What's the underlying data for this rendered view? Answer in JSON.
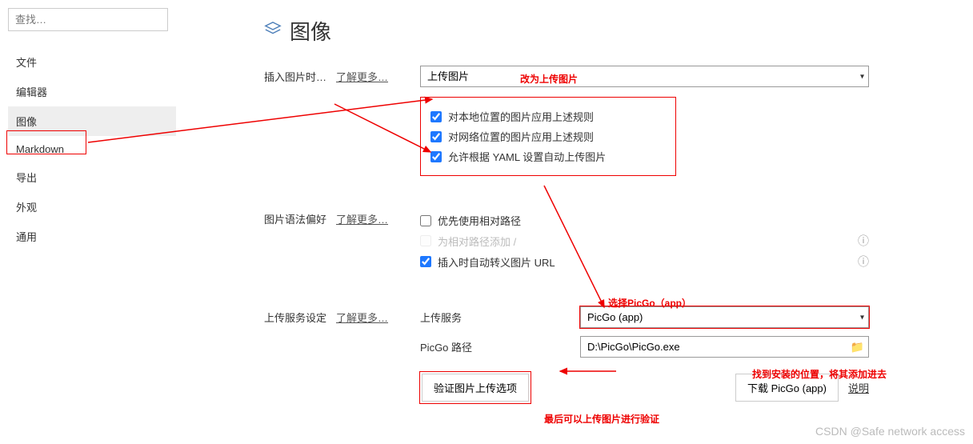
{
  "search": {
    "placeholder": "查找…"
  },
  "sidebar": {
    "items": [
      {
        "label": "文件"
      },
      {
        "label": "编辑器"
      },
      {
        "label": "图像"
      },
      {
        "label": "Markdown"
      },
      {
        "label": "导出"
      },
      {
        "label": "外观"
      },
      {
        "label": "通用"
      }
    ]
  },
  "page": {
    "title": "图像"
  },
  "insert": {
    "label": "插入图片时…",
    "learn_more": "了解更多…",
    "select_value": "上传图片",
    "checkboxes": {
      "local": "对本地位置的图片应用上述规则",
      "network": "对网络位置的图片应用上述规则",
      "yaml": "允许根据 YAML 设置自动上传图片"
    }
  },
  "syntax": {
    "label": "图片语法偏好",
    "learn_more": "了解更多…",
    "relative": "优先使用相对路径",
    "prefix": "为相对路径添加 /",
    "escape": "插入时自动转义图片 URL"
  },
  "upload": {
    "label": "上传服务设定",
    "learn_more": "了解更多…",
    "service_label": "上传服务",
    "service_value": "PicGo (app)",
    "path_label": "PicGo 路径",
    "path_value": "D:\\PicGo\\PicGo.exe",
    "validate_btn": "验证图片上传选项",
    "download_btn": "下载 PicGo (app)",
    "explain": "说明"
  },
  "annotations": {
    "change_to_upload": "改为上传图片",
    "select_picgo": "选择PicGo（app）",
    "find_install": "找到安装的位置，将其添加进去",
    "verify": "最后可以上传图片进行验证"
  },
  "watermark": "CSDN @Safe network access"
}
